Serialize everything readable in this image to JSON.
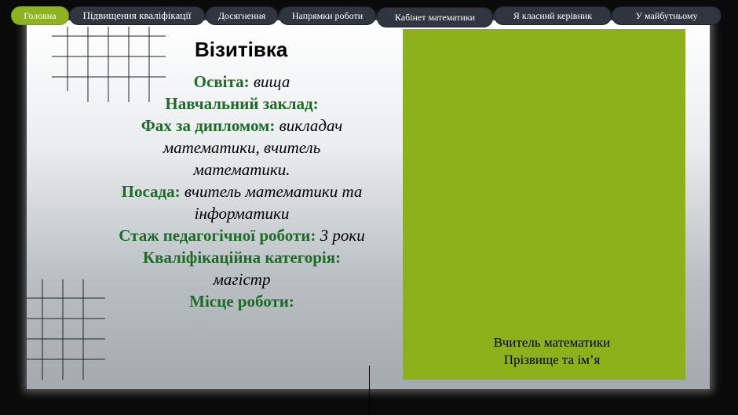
{
  "nav": {
    "tabs": [
      {
        "label": "Головна",
        "active": true
      },
      {
        "label": "Підвищення кваліфікації",
        "active": false
      },
      {
        "label": "Досягнення",
        "active": false
      },
      {
        "label": "Напрямки  роботи",
        "active": false
      },
      {
        "label": "Кабінет математики",
        "active": false
      },
      {
        "label": "Я класний  керівник",
        "active": false
      },
      {
        "label": "У майбутньому",
        "active": false
      }
    ]
  },
  "card": {
    "title": "Візитівка",
    "education_label": "Освіта:",
    "education_value": "вища",
    "institution_label": "Навчальний заклад:",
    "specialty_label": "Фах за дипломом:",
    "specialty_value": "викладач математики, вчитель математики.",
    "position_label": "Посада:",
    "position_value": "вчитель математики та інформатики",
    "experience_label": "Стаж педагогічної роботи:",
    "experience_value": "3 роки",
    "category_label": "Кваліфікаційна  категорія:",
    "category_value": "магістр",
    "workplace_label": "Місце роботи:"
  },
  "photo": {
    "caption_line1": "Вчитель математики",
    "caption_line2": "Прізвище та ім’я",
    "fill_color": "#8db11b"
  }
}
